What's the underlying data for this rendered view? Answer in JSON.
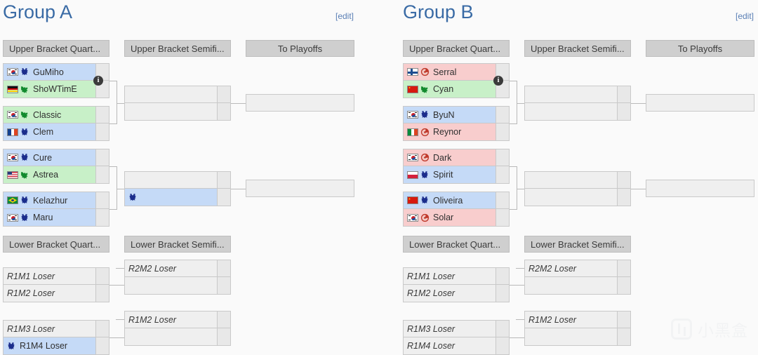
{
  "page": {
    "background": "#fafafa",
    "title_color": "#3a6ba5",
    "race_colors": {
      "terran": "#c5daf7",
      "protoss": "#c8f0c8",
      "zerg": "#f8cdcd"
    },
    "watermark_text": "小黑盒"
  },
  "groups": [
    {
      "id": "group-a",
      "title": "Group A",
      "edit_label": "[edit]",
      "round_headers": {
        "ubqf": "Upper Bracket Quart...",
        "ubsf": "Upper Bracket Semifi...",
        "playoffs": "To Playoffs",
        "lbqf": "Lower Bracket Quart...",
        "lbsf": "Lower Bracket Semifi..."
      },
      "upper_quarters": [
        {
          "id": "ubqf1",
          "has_info": true,
          "rows": [
            {
              "name": "GuMiho",
              "flag": "kr",
              "race": "terran",
              "score": ""
            },
            {
              "name": "ShoWTimE",
              "flag": "de",
              "race": "protoss",
              "score": ""
            }
          ]
        },
        {
          "id": "ubqf2",
          "has_info": false,
          "rows": [
            {
              "name": "Classic",
              "flag": "kr",
              "race": "protoss",
              "score": ""
            },
            {
              "name": "Clem",
              "flag": "fr",
              "race": "terran",
              "score": ""
            }
          ]
        },
        {
          "id": "ubqf3",
          "has_info": false,
          "rows": [
            {
              "name": "Cure",
              "flag": "kr",
              "race": "terran",
              "score": ""
            },
            {
              "name": "Astrea",
              "flag": "us",
              "race": "protoss",
              "score": ""
            }
          ]
        },
        {
          "id": "ubqf4",
          "has_info": false,
          "rows": [
            {
              "name": "Kelazhur",
              "flag": "br",
              "race": "terran",
              "score": ""
            },
            {
              "name": "Maru",
              "flag": "kr",
              "race": "terran",
              "score": ""
            }
          ]
        }
      ],
      "upper_semis": [
        {
          "id": "ubsf1",
          "rows": [
            {
              "name": "",
              "flag": "",
              "race": "",
              "score": ""
            },
            {
              "name": "",
              "flag": "",
              "race": "",
              "score": ""
            }
          ]
        },
        {
          "id": "ubsf2",
          "rows": [
            {
              "name": "",
              "flag": "",
              "race": "",
              "score": ""
            },
            {
              "name": "",
              "flag": "",
              "race": "terran",
              "score": "",
              "hovered": true
            }
          ]
        }
      ],
      "playoffs": [
        {
          "id": "pf1",
          "name": ""
        },
        {
          "id": "pf2",
          "name": ""
        }
      ],
      "lower_quarters": [
        {
          "id": "lbqf1",
          "rows": [
            {
              "name": "R1M1 Loser",
              "placeholder": true
            },
            {
              "name": "R1M2 Loser",
              "placeholder": true
            }
          ]
        },
        {
          "id": "lbqf2",
          "rows": [
            {
              "name": "R1M3 Loser",
              "placeholder": true
            },
            {
              "name": "R1M4 Loser",
              "placeholder": false,
              "race": "terran",
              "hovered": true
            }
          ]
        }
      ],
      "lower_semis": [
        {
          "id": "lbsf1",
          "rows": [
            {
              "name": "R2M2 Loser",
              "placeholder": true
            },
            {
              "name": "",
              "placeholder": true
            }
          ]
        },
        {
          "id": "lbsf2",
          "rows": [
            {
              "name": "R1M2 Loser",
              "placeholder": true
            },
            {
              "name": "",
              "placeholder": true
            }
          ]
        }
      ]
    },
    {
      "id": "group-b",
      "title": "Group B",
      "edit_label": "[edit]",
      "round_headers": {
        "ubqf": "Upper Bracket Quart...",
        "ubsf": "Upper Bracket Semifi...",
        "playoffs": "To Playoffs",
        "lbqf": "Lower Bracket Quart...",
        "lbsf": "Lower Bracket Semifi..."
      },
      "upper_quarters": [
        {
          "id": "ubqf1",
          "has_info": true,
          "rows": [
            {
              "name": "Serral",
              "flag": "fi",
              "race": "zerg",
              "score": ""
            },
            {
              "name": "Cyan",
              "flag": "cn",
              "race": "protoss",
              "score": ""
            }
          ]
        },
        {
          "id": "ubqf2",
          "has_info": false,
          "rows": [
            {
              "name": "ByuN",
              "flag": "kr",
              "race": "terran",
              "score": ""
            },
            {
              "name": "Reynor",
              "flag": "it",
              "race": "zerg",
              "score": ""
            }
          ]
        },
        {
          "id": "ubqf3",
          "has_info": false,
          "rows": [
            {
              "name": "Dark",
              "flag": "kr",
              "race": "zerg",
              "score": ""
            },
            {
              "name": "Spirit",
              "flag": "pl",
              "race": "terran",
              "score": ""
            }
          ]
        },
        {
          "id": "ubqf4",
          "has_info": false,
          "rows": [
            {
              "name": "Oliveira",
              "flag": "cn",
              "race": "terran",
              "score": ""
            },
            {
              "name": "Solar",
              "flag": "kr",
              "race": "zerg",
              "score": ""
            }
          ]
        }
      ],
      "upper_semis": [
        {
          "id": "ubsf1",
          "rows": [
            {
              "name": "",
              "flag": "",
              "race": "",
              "score": ""
            },
            {
              "name": "",
              "flag": "",
              "race": "",
              "score": ""
            }
          ]
        },
        {
          "id": "ubsf2",
          "rows": [
            {
              "name": "",
              "flag": "",
              "race": "",
              "score": ""
            },
            {
              "name": "",
              "flag": "",
              "race": "",
              "score": ""
            }
          ]
        }
      ],
      "playoffs": [
        {
          "id": "pf1",
          "name": ""
        },
        {
          "id": "pf2",
          "name": ""
        }
      ],
      "lower_quarters": [
        {
          "id": "lbqf1",
          "rows": [
            {
              "name": "R1M1 Loser",
              "placeholder": true
            },
            {
              "name": "R1M2 Loser",
              "placeholder": true
            }
          ]
        },
        {
          "id": "lbqf2",
          "rows": [
            {
              "name": "R1M3 Loser",
              "placeholder": true
            },
            {
              "name": "R1M4 Loser",
              "placeholder": true
            }
          ]
        }
      ],
      "lower_semis": [
        {
          "id": "lbsf1",
          "rows": [
            {
              "name": "R2M2 Loser",
              "placeholder": true
            },
            {
              "name": "",
              "placeholder": true
            }
          ]
        },
        {
          "id": "lbsf2",
          "rows": [
            {
              "name": "R1M2 Loser",
              "placeholder": true
            },
            {
              "name": "",
              "placeholder": true
            }
          ]
        }
      ]
    }
  ]
}
